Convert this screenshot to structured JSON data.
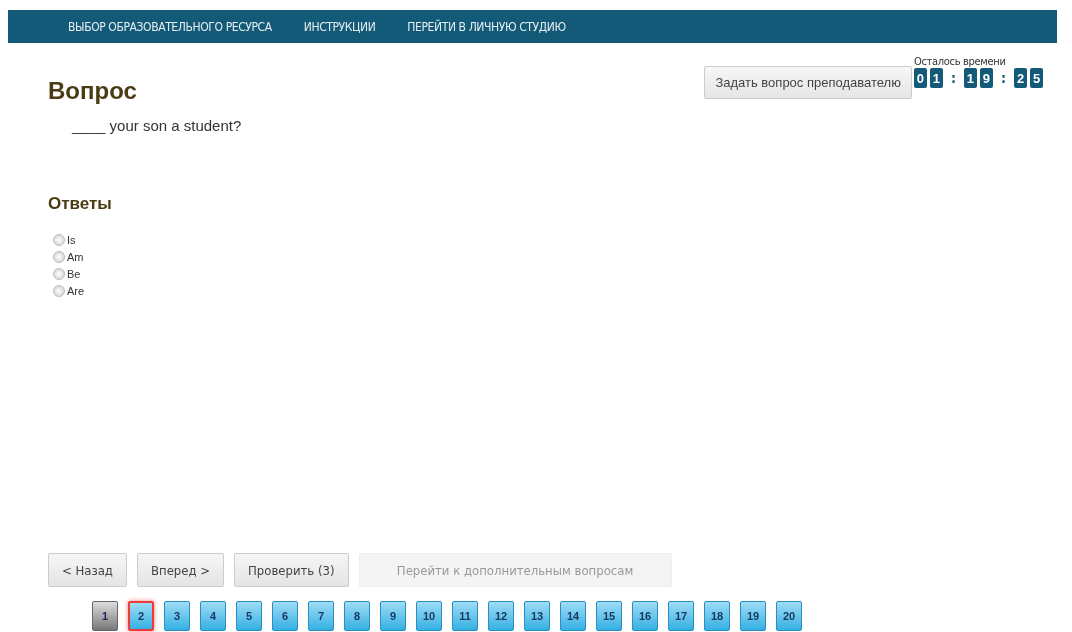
{
  "nav": [
    "ВЫБОР ОБРАЗОВАТЕЛЬНОГО РЕСУРСА",
    "ИНСТРУКЦИИ",
    "ПЕРЕЙТИ В ЛИЧНУЮ СТУДИЮ"
  ],
  "title": "Вопрос",
  "ask_button": "Задать вопрос преподавателю",
  "timer": {
    "label": "Осталось времени",
    "groups": [
      [
        "0",
        "1"
      ],
      [
        "1",
        "9"
      ],
      [
        "2",
        "5"
      ]
    ],
    "separator": ":"
  },
  "question": "____ your son a student?",
  "answers_title": "Ответы",
  "answers": [
    {
      "label": "Is",
      "selected": false
    },
    {
      "label": "Am",
      "selected": false
    },
    {
      "label": "Be",
      "selected": false
    },
    {
      "label": "Are",
      "selected": false
    }
  ],
  "buttons": [
    {
      "label": "< Назад",
      "disabled": false
    },
    {
      "label": "Вперед >",
      "disabled": false
    },
    {
      "label": "Проверить (3)",
      "disabled": false
    },
    {
      "label": "Перейти к дополнительным вопросам",
      "disabled": true
    }
  ],
  "pages": [
    {
      "label": "1",
      "selected": true,
      "marked": false
    },
    {
      "label": "2",
      "selected": false,
      "marked": true
    },
    {
      "label": "3",
      "selected": false,
      "marked": false
    },
    {
      "label": "4",
      "selected": false,
      "marked": false
    },
    {
      "label": "5",
      "selected": false,
      "marked": false
    },
    {
      "label": "6",
      "selected": false,
      "marked": false
    },
    {
      "label": "7",
      "selected": false,
      "marked": false
    },
    {
      "label": "8",
      "selected": false,
      "marked": false
    },
    {
      "label": "9",
      "selected": false,
      "marked": false
    },
    {
      "label": "10",
      "selected": false,
      "marked": false
    },
    {
      "label": "11",
      "selected": false,
      "marked": false
    },
    {
      "label": "12",
      "selected": false,
      "marked": false
    },
    {
      "label": "13",
      "selected": false,
      "marked": false
    },
    {
      "label": "14",
      "selected": false,
      "marked": false
    },
    {
      "label": "15",
      "selected": false,
      "marked": false
    },
    {
      "label": "16",
      "selected": false,
      "marked": false
    },
    {
      "label": "17",
      "selected": false,
      "marked": false
    },
    {
      "label": "18",
      "selected": false,
      "marked": false
    },
    {
      "label": "19",
      "selected": false,
      "marked": false
    },
    {
      "label": "20",
      "selected": false,
      "marked": false
    }
  ]
}
